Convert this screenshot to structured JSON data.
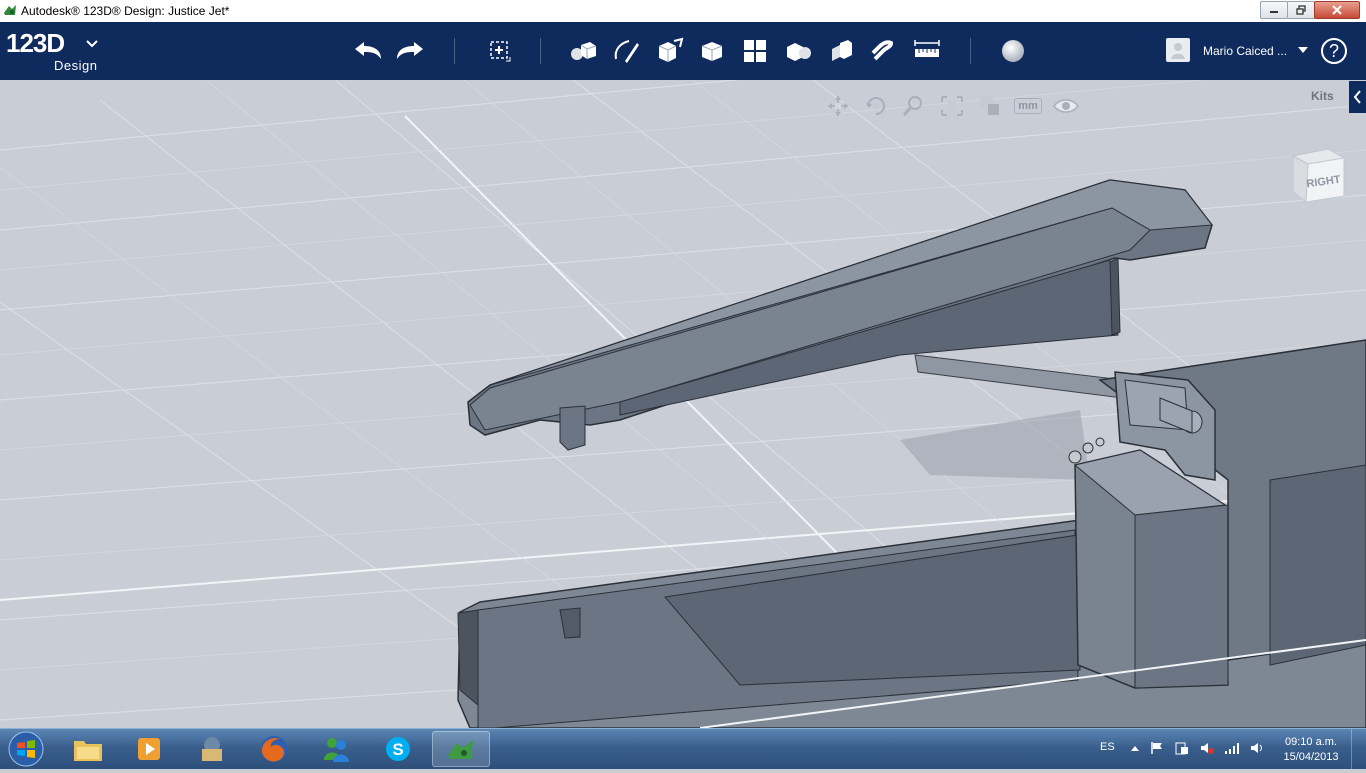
{
  "window": {
    "title": "Autodesk® 123D® Design: Justice Jet*"
  },
  "toolbar": {
    "logo_text": "123D",
    "logo_sub": "Design",
    "user_name": "Mario Caiced ...",
    "help_label": "?"
  },
  "viewport": {
    "units_label": "mm",
    "kits_label": "Kits",
    "viewcube_face": "RIGHT"
  },
  "tray": {
    "language": "ES",
    "time": "09:10 a.m.",
    "date": "15/04/2013"
  },
  "colors": {
    "toolbar_bg": "#0f2a5c",
    "model_gray": "#7e8894",
    "grid_bg": "#c9ced6"
  }
}
